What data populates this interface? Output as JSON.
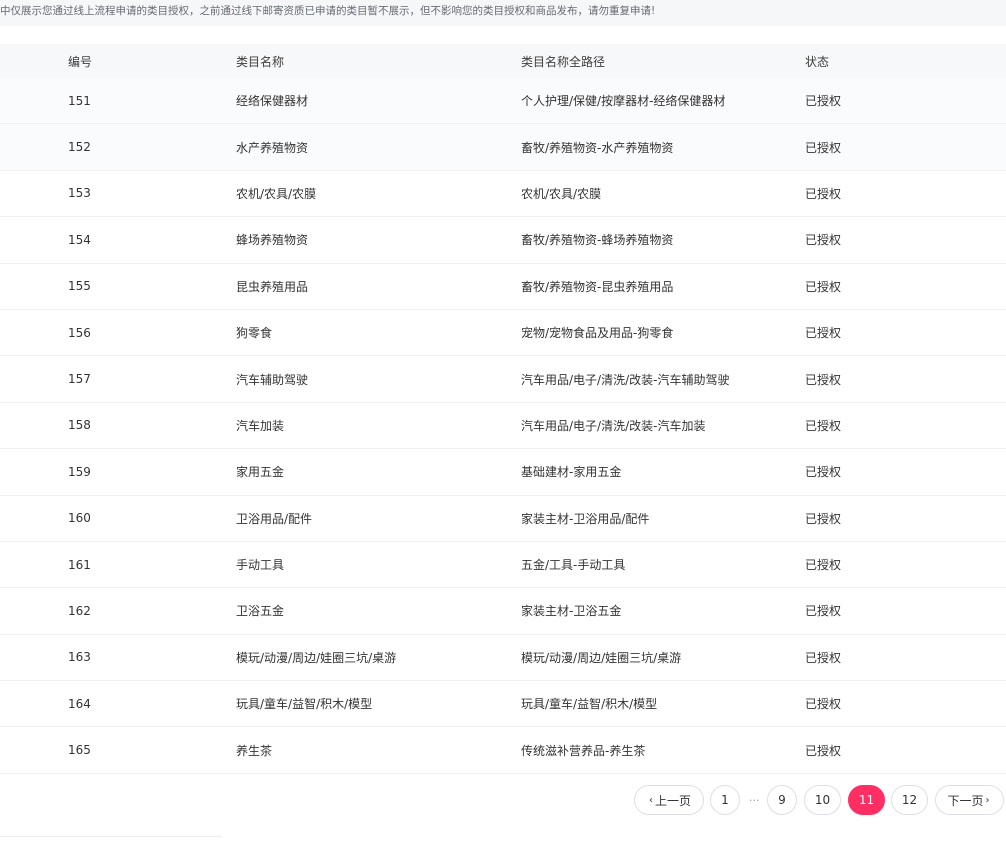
{
  "notice": "中仅展示您通过线上流程申请的类目授权，之前通过线下邮寄资质已申请的类目暂不展示，但不影响您的类目授权和商品发布，请勿重复申请!",
  "table": {
    "headers": [
      "编号",
      "类目名称",
      "类目名称全路径",
      "状态"
    ],
    "rows": [
      {
        "id": "151",
        "name": "经络保健器材",
        "path": "个人护理/保健/按摩器材-经络保健器材",
        "status": "已授权"
      },
      {
        "id": "152",
        "name": "水产养殖物资",
        "path": "畜牧/养殖物资-水产养殖物资",
        "status": "已授权"
      },
      {
        "id": "153",
        "name": "农机/农具/农膜",
        "path": "农机/农具/农膜",
        "status": "已授权"
      },
      {
        "id": "154",
        "name": "蜂场养殖物资",
        "path": "畜牧/养殖物资-蜂场养殖物资",
        "status": "已授权"
      },
      {
        "id": "155",
        "name": "昆虫养殖用品",
        "path": "畜牧/养殖物资-昆虫养殖用品",
        "status": "已授权"
      },
      {
        "id": "156",
        "name": "狗零食",
        "path": "宠物/宠物食品及用品-狗零食",
        "status": "已授权"
      },
      {
        "id": "157",
        "name": "汽车辅助驾驶",
        "path": "汽车用品/电子/清洗/改装-汽车辅助驾驶",
        "status": "已授权"
      },
      {
        "id": "158",
        "name": "汽车加装",
        "path": "汽车用品/电子/清洗/改装-汽车加装",
        "status": "已授权"
      },
      {
        "id": "159",
        "name": "家用五金",
        "path": "基础建材-家用五金",
        "status": "已授权"
      },
      {
        "id": "160",
        "name": "卫浴用品/配件",
        "path": "家装主材-卫浴用品/配件",
        "status": "已授权"
      },
      {
        "id": "161",
        "name": "手动工具",
        "path": "五金/工具-手动工具",
        "status": "已授权"
      },
      {
        "id": "162",
        "name": "卫浴五金",
        "path": "家装主材-卫浴五金",
        "status": "已授权"
      },
      {
        "id": "163",
        "name": "模玩/动漫/周边/娃圈三坑/桌游",
        "path": "模玩/动漫/周边/娃圈三坑/桌游",
        "status": "已授权"
      },
      {
        "id": "164",
        "name": "玩具/童车/益智/积木/模型",
        "path": "玩具/童车/益智/积木/模型",
        "status": "已授权"
      },
      {
        "id": "165",
        "name": "养生茶",
        "path": "传统滋补营养品-养生茶",
        "status": "已授权"
      }
    ]
  },
  "pagination": {
    "prev_label": "上一页",
    "next_label": "下一页",
    "ellipsis": "···",
    "pages": [
      "1",
      "9",
      "10",
      "11",
      "12"
    ],
    "current": "11"
  },
  "colors": {
    "accent": "#ff2e63",
    "header_bg": "#f7f8fa",
    "row_border": "#f0f1f3"
  },
  "icons": {
    "prev": "chevron-left-icon",
    "next": "chevron-right-icon"
  }
}
